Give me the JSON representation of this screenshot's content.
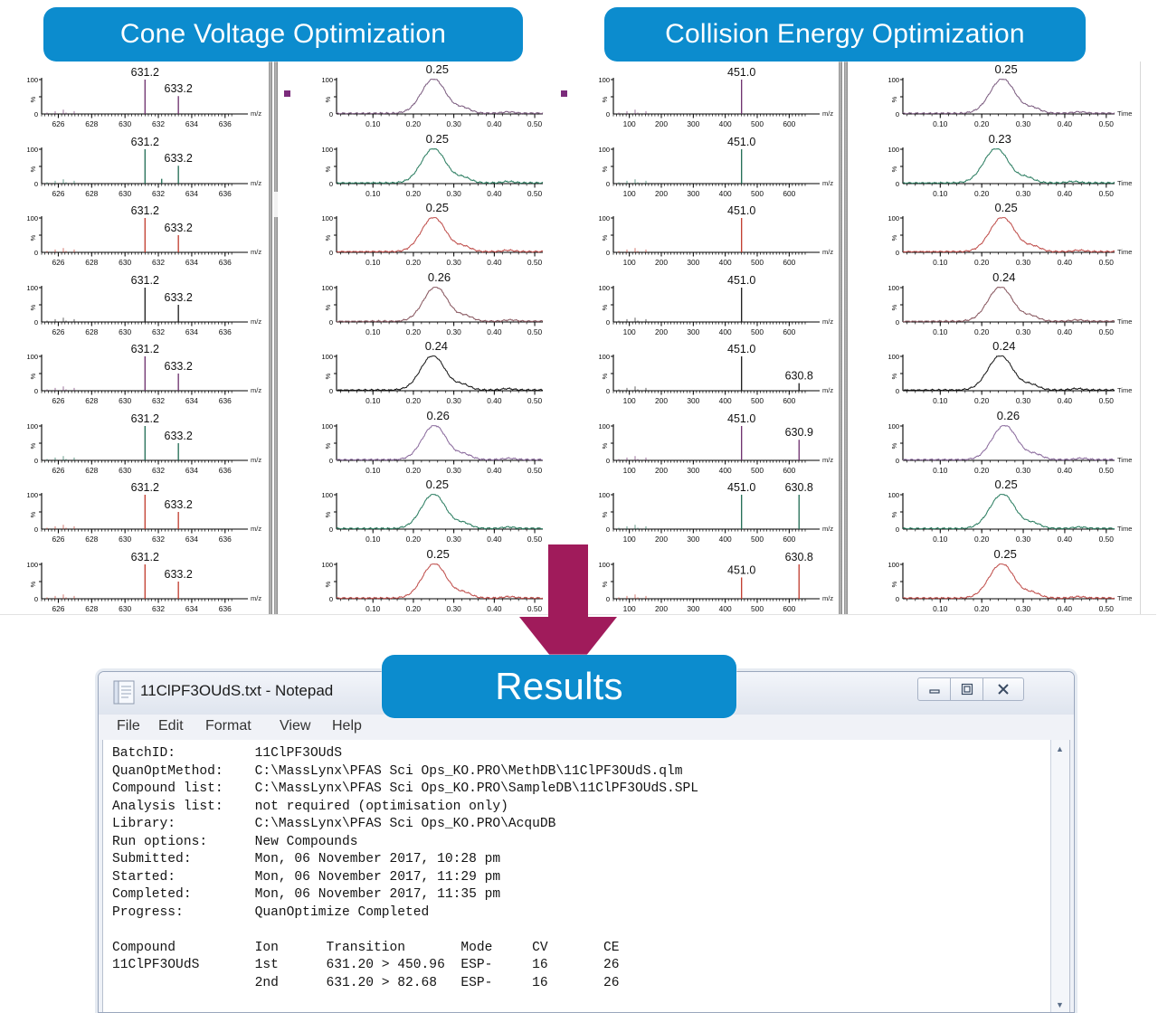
{
  "banners": {
    "cone": "Cone Voltage Optimization",
    "collision": "Collision Energy Optimization",
    "results": "Results",
    "color": "#0C8CCE"
  },
  "arrow": {
    "name": "down-arrow",
    "color": "#A01B5B"
  },
  "axis_labels": {
    "mz": "m/z",
    "time": "Time",
    "percent": "%",
    "hundred": "100",
    "zero": "0"
  },
  "notepad": {
    "title": "11ClPF3OUdS.txt - Notepad",
    "menu": [
      "File",
      "Edit",
      "Format",
      "View",
      "Help"
    ],
    "buttons": {
      "minimize": "minimize",
      "maximize": "maximize",
      "close": "close"
    },
    "text": "BatchID:          11ClPF3OUdS\nQuanOptMethod:    C:\\MassLynx\\PFAS Sci Ops_KO.PRO\\MethDB\\11ClPF3OUdS.qlm\nCompound list:    C:\\MassLynx\\PFAS Sci Ops_KO.PRO\\SampleDB\\11ClPF3OUdS.SPL\nAnalysis list:    not required (optimisation only)\nLibrary:          C:\\MassLynx\\PFAS Sci Ops_KO.PRO\\AcquDB\nRun options:      New Compounds\nSubmitted:        Mon, 06 November 2017, 10:28 pm\nStarted:          Mon, 06 November 2017, 11:29 pm\nCompleted:        Mon, 06 November 2017, 11:35 pm\nProgress:         QuanOptimize Completed\n\nCompound          Ion      Transition       Mode     CV       CE\n11ClPF3OUdS       1st      631.20 > 450.96  ESP-     16       26\n                  2nd      631.20 > 82.68   ESP-     16       26"
  },
  "chart_data": [
    {
      "type": "bar",
      "panel": "cone-voltage-ms-spectra",
      "title": "Cone Voltage Optimization - MS spectra",
      "xlabel": "m/z",
      "ylabel": "%",
      "xlim": [
        625,
        636.5
      ],
      "ylim": [
        0,
        100
      ],
      "xticks": [
        626,
        628,
        630,
        632,
        634,
        636
      ],
      "yticks": [
        0,
        100
      ],
      "rows": [
        {
          "index": 1,
          "color": "#6b2d6b",
          "peaks": [
            {
              "mz": 631.2,
              "label": "631.2",
              "height": 100
            },
            {
              "mz": 633.2,
              "label": "633.2",
              "height": 52
            }
          ]
        },
        {
          "index": 2,
          "color": "#1e6b52",
          "peaks": [
            {
              "mz": 631.2,
              "label": "631.2",
              "height": 100
            },
            {
              "mz": 633.2,
              "label": "633.2",
              "height": 52
            },
            {
              "mz": 632.2,
              "label": "",
              "height": 14
            }
          ]
        },
        {
          "index": 3,
          "color": "#c0392b",
          "peaks": [
            {
              "mz": 631.2,
              "label": "631.2",
              "height": 100
            },
            {
              "mz": 633.2,
              "label": "633.2",
              "height": 50
            }
          ]
        },
        {
          "index": 4,
          "color": "#1a1a1a",
          "peaks": [
            {
              "mz": 631.2,
              "label": "631.2",
              "height": 100
            },
            {
              "mz": 633.2,
              "label": "633.2",
              "height": 50
            }
          ]
        },
        {
          "index": 5,
          "color": "#6b2d6b",
          "peaks": [
            {
              "mz": 631.2,
              "label": "631.2",
              "height": 100
            },
            {
              "mz": 633.2,
              "label": "633.2",
              "height": 50
            }
          ]
        },
        {
          "index": 6,
          "color": "#1e6b52",
          "peaks": [
            {
              "mz": 631.2,
              "label": "631.2",
              "height": 100
            },
            {
              "mz": 633.2,
              "label": "633.2",
              "height": 50
            }
          ]
        },
        {
          "index": 7,
          "color": "#c0392b",
          "peaks": [
            {
              "mz": 631.2,
              "label": "631.2",
              "height": 100
            },
            {
              "mz": 633.2,
              "label": "633.2",
              "height": 50
            }
          ]
        },
        {
          "index": 8,
          "color": "#c0392b",
          "peaks": [
            {
              "mz": 631.2,
              "label": "631.2",
              "height": 100
            },
            {
              "mz": 633.2,
              "label": "633.2",
              "height": 50
            }
          ]
        }
      ]
    },
    {
      "type": "line",
      "panel": "cone-voltage-chromatograms",
      "title": "Cone Voltage Optimization - chromatograms",
      "xlabel": "",
      "ylabel": "%",
      "xlim": [
        0.01,
        0.52
      ],
      "ylim": [
        0,
        100
      ],
      "xticks": [
        0.1,
        0.2,
        0.3,
        0.4,
        0.5
      ],
      "xticklabels": [
        "0.10",
        "0.20",
        "0.30",
        "0.40",
        "0.50"
      ],
      "yticks": [
        0,
        100
      ],
      "rows": [
        {
          "index": 1,
          "color": "#7e5f82",
          "peak_label": "0.25",
          "rt": 0.25
        },
        {
          "index": 2,
          "color": "#2e7f63",
          "peak_label": "0.25",
          "rt": 0.25
        },
        {
          "index": 3,
          "color": "#c0504d",
          "peak_label": "0.25",
          "rt": 0.25
        },
        {
          "index": 4,
          "color": "#8a5a62",
          "peak_label": "0.26",
          "rt": 0.255
        },
        {
          "index": 5,
          "color": "#1a1a1a",
          "peak_label": "0.24",
          "rt": 0.248
        },
        {
          "index": 6,
          "color": "#8c6d9e",
          "peak_label": "0.26",
          "rt": 0.252
        },
        {
          "index": 7,
          "color": "#2e7f63",
          "peak_label": "0.25",
          "rt": 0.25
        },
        {
          "index": 8,
          "color": "#c0504d",
          "peak_label": "0.25",
          "rt": 0.252
        }
      ]
    },
    {
      "type": "bar",
      "panel": "collision-energy-ms-spectra",
      "title": "Collision Energy Optimization - MS spectra",
      "xlabel": "m/z",
      "ylabel": "%",
      "xlim": [
        50,
        650
      ],
      "ylim": [
        0,
        100
      ],
      "xticks": [
        100,
        200,
        300,
        400,
        500,
        600
      ],
      "yticks": [
        0,
        100
      ],
      "rows": [
        {
          "index": 1,
          "color": "#6b2d6b",
          "peaks": [
            {
              "mz": 451.0,
              "label": "451.0",
              "height": 100
            }
          ]
        },
        {
          "index": 2,
          "color": "#1e6b52",
          "peaks": [
            {
              "mz": 451.0,
              "label": "451.0",
              "height": 100
            }
          ]
        },
        {
          "index": 3,
          "color": "#c0392b",
          "peaks": [
            {
              "mz": 451.0,
              "label": "451.0",
              "height": 100
            }
          ]
        },
        {
          "index": 4,
          "color": "#1a1a1a",
          "peaks": [
            {
              "mz": 451.0,
              "label": "451.0",
              "height": 100
            }
          ]
        },
        {
          "index": 5,
          "color": "#1a1a1a",
          "peaks": [
            {
              "mz": 451.0,
              "label": "451.0",
              "height": 100
            },
            {
              "mz": 630.8,
              "label": "630.8",
              "height": 22
            }
          ]
        },
        {
          "index": 6,
          "color": "#6b2d6b",
          "peaks": [
            {
              "mz": 451.0,
              "label": "451.0",
              "height": 100
            },
            {
              "mz": 630.9,
              "label": "630.9",
              "height": 60
            }
          ]
        },
        {
          "index": 7,
          "color": "#1e6b52",
          "peaks": [
            {
              "mz": 451.0,
              "label": "451.0",
              "height": 100
            },
            {
              "mz": 630.8,
              "label": "630.8",
              "height": 100
            }
          ]
        },
        {
          "index": 8,
          "color": "#c0392b",
          "peaks": [
            {
              "mz": 451.0,
              "label": "451.0",
              "height": 62
            },
            {
              "mz": 630.8,
              "label": "630.8",
              "height": 100
            }
          ]
        }
      ]
    },
    {
      "type": "line",
      "panel": "collision-energy-chromatograms",
      "title": "Collision Energy Optimization - chromatograms",
      "xlabel": "Time",
      "ylabel": "%",
      "xlim": [
        0.01,
        0.52
      ],
      "ylim": [
        0,
        100
      ],
      "xticks": [
        0.1,
        0.2,
        0.3,
        0.4,
        0.5
      ],
      "xticklabels": [
        "0.10",
        "0.20",
        "0.30",
        "0.40",
        "0.50"
      ],
      "yticks": [
        0,
        100
      ],
      "rows": [
        {
          "index": 1,
          "color": "#7e5f82",
          "peak_label": "0.25",
          "rt": 0.25
        },
        {
          "index": 2,
          "color": "#2e7f63",
          "peak_label": "0.23",
          "rt": 0.235
        },
        {
          "index": 3,
          "color": "#c0504d",
          "peak_label": "0.25",
          "rt": 0.25
        },
        {
          "index": 4,
          "color": "#8a5a62",
          "peak_label": "0.24",
          "rt": 0.245
        },
        {
          "index": 5,
          "color": "#1a1a1a",
          "peak_label": "0.24",
          "rt": 0.245
        },
        {
          "index": 6,
          "color": "#8c6d9e",
          "peak_label": "0.26",
          "rt": 0.255
        },
        {
          "index": 7,
          "color": "#2e7f63",
          "peak_label": "0.25",
          "rt": 0.25
        },
        {
          "index": 8,
          "color": "#c0504d",
          "peak_label": "0.25",
          "rt": 0.248
        }
      ]
    }
  ]
}
